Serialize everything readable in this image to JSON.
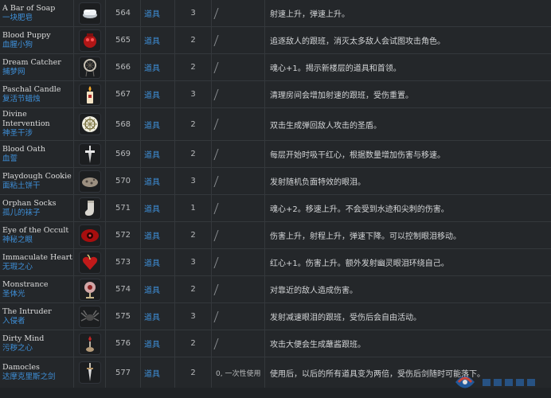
{
  "rows": [
    {
      "en": "A Bar of Soap",
      "cn": "一块肥皂",
      "id": "564",
      "type": "道具",
      "quality": "3",
      "desc": "射速上升，弹速上升。",
      "icon": "soap-icon"
    },
    {
      "en": "Blood Puppy",
      "cn": "血腥小狗",
      "id": "565",
      "type": "道具",
      "quality": "2",
      "desc": "追逐敌人的跟班，消灭太多敌人会试图攻击角色。",
      "icon": "blood-puppy-icon"
    },
    {
      "en": "Dream Catcher",
      "cn": "捕梦网",
      "id": "566",
      "type": "道具",
      "quality": "2",
      "desc": "魂心+1。揭示新楼层的道具和首领。",
      "icon": "dream-catcher-icon"
    },
    {
      "en": "Paschal Candle",
      "cn": "复活节蜡烛",
      "id": "567",
      "type": "道具",
      "quality": "3",
      "desc": "清理房间会增加射速的跟班，受伤重置。",
      "icon": "candle-icon"
    },
    {
      "en": "Divine",
      "en2": "Intervention",
      "cn": "神圣干涉",
      "id": "568",
      "type": "道具",
      "quality": "2",
      "desc": "双击生成弹回敌人攻击的圣盾。",
      "icon": "divine-shield-icon",
      "tall": true
    },
    {
      "en": "Blood Oath",
      "cn": "血誓",
      "id": "569",
      "type": "道具",
      "quality": "2",
      "desc": "每层开始时吸干红心，根据数量增加伤害与移速。",
      "icon": "dagger-icon"
    },
    {
      "en": "Playdough Cookie",
      "cn": "面粘土饼干",
      "id": "570",
      "type": "道具",
      "quality": "3",
      "desc": "发射随机负面特效的眼泪。",
      "icon": "cookie-icon"
    },
    {
      "en": "Orphan Socks",
      "cn": "孤儿的袜子",
      "id": "571",
      "type": "道具",
      "quality": "1",
      "desc": "魂心+2。移速上升。不会受到水迹和尖刺的伤害。",
      "icon": "sock-icon"
    },
    {
      "en": "Eye of the Occult",
      "cn": "神秘之眼",
      "id": "572",
      "type": "道具",
      "quality": "2",
      "desc": "伤害上升，射程上升，弹速下降。可以控制眼泪移动。",
      "icon": "occult-eye-icon"
    },
    {
      "en": "Immaculate Heart",
      "cn": "无瑕之心",
      "id": "573",
      "type": "道具",
      "quality": "3",
      "desc": "红心+1。伤害上升。额外发射幽灵眼泪环绕自己。",
      "icon": "heart-icon"
    },
    {
      "en": "Monstrance",
      "cn": "圣体光",
      "id": "574",
      "type": "道具",
      "quality": "2",
      "desc": "对靠近的敌人造成伤害。",
      "icon": "monstrance-icon"
    },
    {
      "en": "The Intruder",
      "cn": "入侵者",
      "id": "575",
      "type": "道具",
      "quality": "3",
      "desc": "发射减速眼泪的跟班，受伤后会自由活动。",
      "icon": "spider-icon"
    },
    {
      "en": "Dirty Mind",
      "cn": "污秽之心",
      "id": "576",
      "type": "道具",
      "quality": "2",
      "desc": "攻击大便会生成蘸酱跟班。",
      "icon": "dirty-mind-icon"
    },
    {
      "en": "Damocles",
      "cn": "达摩克里斯之剑",
      "id": "577",
      "type": "道具",
      "quality": "2",
      "use": "0, 一次性使用",
      "desc": "使用后，以后的所有道具变为两倍，受伤后剑随时可能落下。",
      "icon": "damocles-icon",
      "last": true
    }
  ],
  "colors": {
    "link": "#3e8fd8",
    "bg": "#24272a",
    "border": "#34383c"
  }
}
